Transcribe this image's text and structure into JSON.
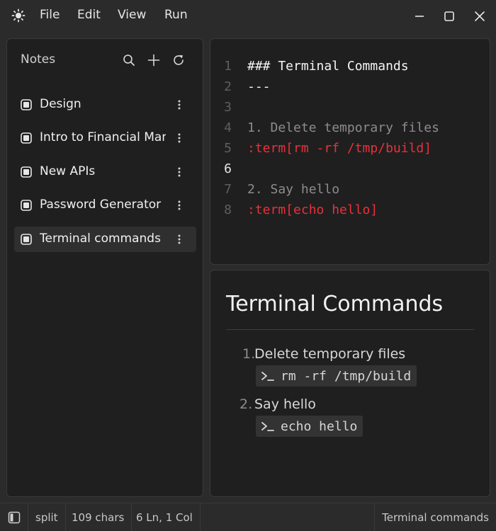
{
  "menu": {
    "file": "File",
    "edit": "Edit",
    "view": "View",
    "run": "Run"
  },
  "sidebar": {
    "title": "Notes",
    "items": [
      {
        "label": "Design"
      },
      {
        "label": "Intro to Financial Management"
      },
      {
        "label": "New APIs"
      },
      {
        "label": "Password Generator"
      },
      {
        "label": "Terminal commands"
      }
    ],
    "active_index": 4
  },
  "editor": {
    "current_line": 6,
    "lines": [
      {
        "n": "1",
        "text": "### Terminal Commands"
      },
      {
        "n": "2",
        "text": "---"
      },
      {
        "n": "3",
        "text": ""
      },
      {
        "n": "4",
        "text": "1. Delete temporary files"
      },
      {
        "n": "5",
        "text": ":term[rm -rf /tmp/build]"
      },
      {
        "n": "6",
        "text": ""
      },
      {
        "n": "7",
        "text": "2. Say hello"
      },
      {
        "n": "8",
        "text": ":term[echo hello]"
      }
    ]
  },
  "preview": {
    "title": "Terminal Commands",
    "items": [
      {
        "num": "1.",
        "text": "Delete temporary files",
        "code": "rm -rf /tmp/build"
      },
      {
        "num": "2.",
        "text": "Say hello",
        "code": "echo hello"
      }
    ]
  },
  "status": {
    "mode": "split",
    "chars": "109 chars",
    "position": "6 Ln, 1 Col",
    "note_name": "Terminal commands"
  },
  "colors": {
    "background": "#2b2b2b",
    "panel": "#1f1f1f",
    "directive": "#e8313b",
    "active_item": "#2f2f2f"
  }
}
